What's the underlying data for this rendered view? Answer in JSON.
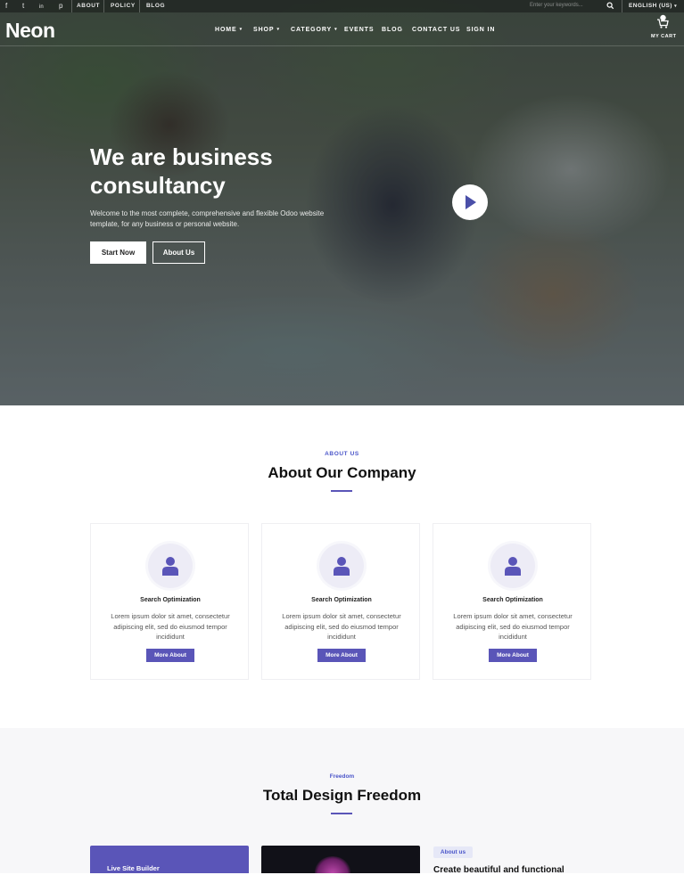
{
  "topbar": {
    "social": [
      "f",
      "t",
      "in",
      "p"
    ],
    "links": [
      "ABOUT",
      "POLICY",
      "BLOG"
    ],
    "search_placeholder": "Enter your keywords...",
    "language": "ENGLISH (US)"
  },
  "nav": {
    "logo": "Neon",
    "items": [
      {
        "label": "HOME",
        "dropdown": true
      },
      {
        "label": "SHOP",
        "dropdown": true
      },
      {
        "label": "CATEGORY",
        "dropdown": true
      },
      {
        "label": "EVENTS",
        "dropdown": false
      },
      {
        "label": "BLOG",
        "dropdown": false
      },
      {
        "label": "CONTACT US",
        "dropdown": false
      },
      {
        "label": "SIGN IN",
        "dropdown": false
      }
    ],
    "cart_label": "MY CART",
    "caret": "▾"
  },
  "hero": {
    "title": "We are business consultancy",
    "description": "Welcome to the most complete, comprehensive and flexible Odoo website template, for any business or personal website.",
    "primary_button": "Start Now",
    "secondary_button": "About Us"
  },
  "about": {
    "eyebrow": "ABOUT US",
    "title": "About Our Company",
    "cards": [
      {
        "title": "Search Optimization",
        "text": "Lorem ipsum dolor sit amet, consectetur adipiscing elit, sed do eiusmod tempor incididunt",
        "button": "More About"
      },
      {
        "title": "Search Optimization",
        "text": "Lorem ipsum dolor sit amet, consectetur adipiscing elit, sed do eiusmod tempor incididunt",
        "button": "More About"
      },
      {
        "title": "Search Optimization",
        "text": "Lorem ipsum dolor sit amet, consectetur adipiscing elit, sed do eiusmod tempor incididunt",
        "button": "More About"
      }
    ]
  },
  "freedom": {
    "eyebrow": "Freedom",
    "title": "Total Design Freedom",
    "live_label": "Live Site Builder",
    "pill": "About us",
    "heading": "Create beautiful and functional"
  },
  "colors": {
    "accent": "#5a55b8",
    "link_blue": "#4a55c9"
  }
}
